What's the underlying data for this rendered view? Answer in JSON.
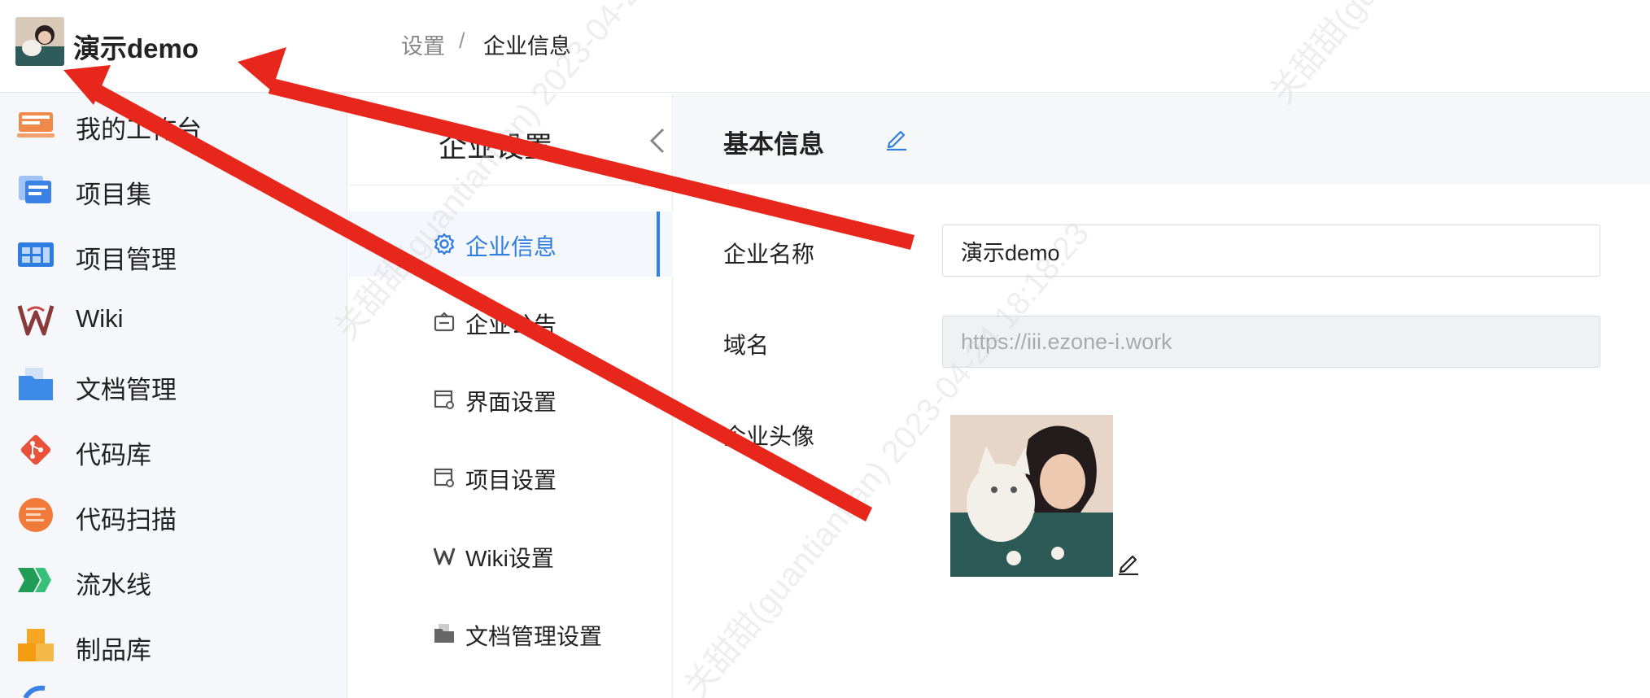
{
  "brand": {
    "name": "演示demo"
  },
  "sidebar": {
    "items": [
      {
        "label": "我的工作台",
        "icon": "workbench-icon"
      },
      {
        "label": "项目集",
        "icon": "project-set-icon"
      },
      {
        "label": "项目管理",
        "icon": "project-management-icon"
      },
      {
        "label": "Wiki",
        "icon": "wiki-icon"
      },
      {
        "label": "文档管理",
        "icon": "document-folder-icon"
      },
      {
        "label": "代码库",
        "icon": "git-repo-icon"
      },
      {
        "label": "代码扫描",
        "icon": "code-scan-icon"
      },
      {
        "label": "流水线",
        "icon": "pipeline-icon"
      },
      {
        "label": "制品库",
        "icon": "artifact-icon"
      }
    ]
  },
  "breadcrumb": {
    "parent": "设置",
    "separator": "/",
    "current": "企业信息"
  },
  "submenu": {
    "title": "企业设置",
    "items": [
      {
        "label": "企业信息",
        "icon": "gear-icon",
        "active": true
      },
      {
        "label": "企业公告",
        "icon": "announcement-icon"
      },
      {
        "label": "界面设置",
        "icon": "window-settings-icon"
      },
      {
        "label": "项目设置",
        "icon": "window-settings-icon"
      },
      {
        "label": "Wiki设置",
        "icon": "wiki-icon"
      },
      {
        "label": "文档管理设置",
        "icon": "folder-icon"
      }
    ]
  },
  "main": {
    "section_title": "基本信息",
    "fields": {
      "name_label": "企业名称",
      "name_value": "演示demo",
      "domain_label": "域名",
      "domain_placeholder": "https://iii.ezone-i.work",
      "avatar_label": "企业头像"
    }
  },
  "watermark": {
    "text": "关甜甜(guantiantian) 2023-04-24 18:18:23"
  },
  "colors": {
    "accent": "#2f80ed",
    "arrow": "#e8271c"
  }
}
